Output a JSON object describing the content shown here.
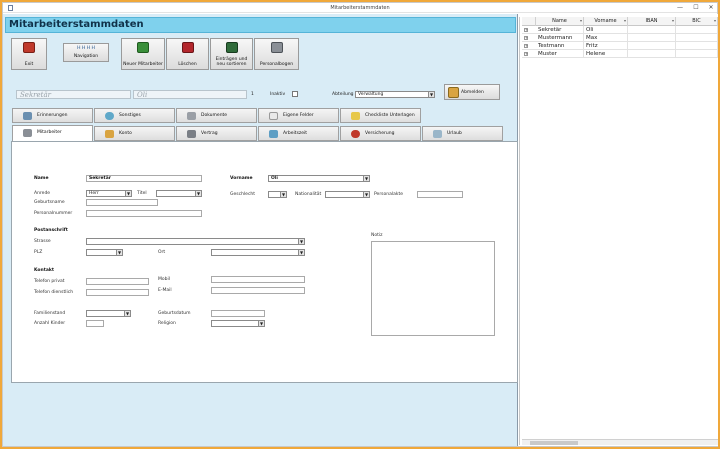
{
  "window": {
    "title": "Mitarbeiterstammdaten",
    "controls": [
      "—",
      "☐",
      "✕"
    ]
  },
  "form_header": "Mitarbeiterstammdaten",
  "toolbar": {
    "exit": "Exit",
    "navigation": "Navigation",
    "nav_glyphs": "H  H  H  H",
    "new_employee": "Neuer Mitarbeiter",
    "delete": "Löschen",
    "entries_sort": "Einträgen und neu sortieren",
    "personnel_form": "Personalbogen"
  },
  "record": {
    "name_display": "Sekretär",
    "firstname_display": "Oli",
    "counter": "1",
    "inactive_label": "Inaktiv",
    "department_label": "Abteilung",
    "department_value": "Verwaltung",
    "deregister": "Abmelden"
  },
  "tabs_row1": [
    "Erinnerungen",
    "Sonstiges",
    "Dokumente",
    "Eigene Felder",
    "Checkliste Unterlagen"
  ],
  "tabs_row2": [
    "Mitarbeiter",
    "Konto",
    "Vertrag",
    "Arbeitszeit",
    "Versicherung",
    "Urlaub"
  ],
  "fields": {
    "name_label": "Name",
    "name_value": "Sekretär",
    "vorname_label": "Vorname",
    "vorname_value": "Oli",
    "anrede_label": "Anrede",
    "anrede_value": "Herr",
    "titel_label": "Titel",
    "geschlecht_label": "Geschlecht",
    "nationalitaet_label": "Nationalität",
    "personalakte_label": "Personalakte",
    "geburtsname_label": "Geburtsname",
    "personalnummer_label": "Personalnummer",
    "postanschrift_label": "Postanschrift",
    "strasse_label": "Strasse",
    "plz_label": "PLZ",
    "ort_label": "Ort",
    "kontakt_label": "Kontakt",
    "telefon_privat_label": "Telefon privat",
    "telefon_dienstlich_label": "Telefon dienstlich",
    "mobil_label": "Mobil",
    "email_label": "E-Mail",
    "familienstand_label": "Familienstand",
    "geburtsdatum_label": "Geburtsdatum",
    "anzahl_kinder_label": "Anzahl Kinder",
    "religion_label": "Religion",
    "notiz_label": "Notiz"
  },
  "list": {
    "columns": [
      "Name",
      "Vorname",
      "IBAN",
      "BIC"
    ],
    "rows": [
      {
        "name": "Sekretär",
        "vorname": "Oli"
      },
      {
        "name": "Mustermann",
        "vorname": "Max"
      },
      {
        "name": "Testmann",
        "vorname": "Fritz"
      },
      {
        "name": "Muster",
        "vorname": "Helene"
      }
    ]
  },
  "colors": {
    "header": "#7fd1ed",
    "form_bg": "#d9ecf6",
    "border_orange": "#f0a83a"
  }
}
